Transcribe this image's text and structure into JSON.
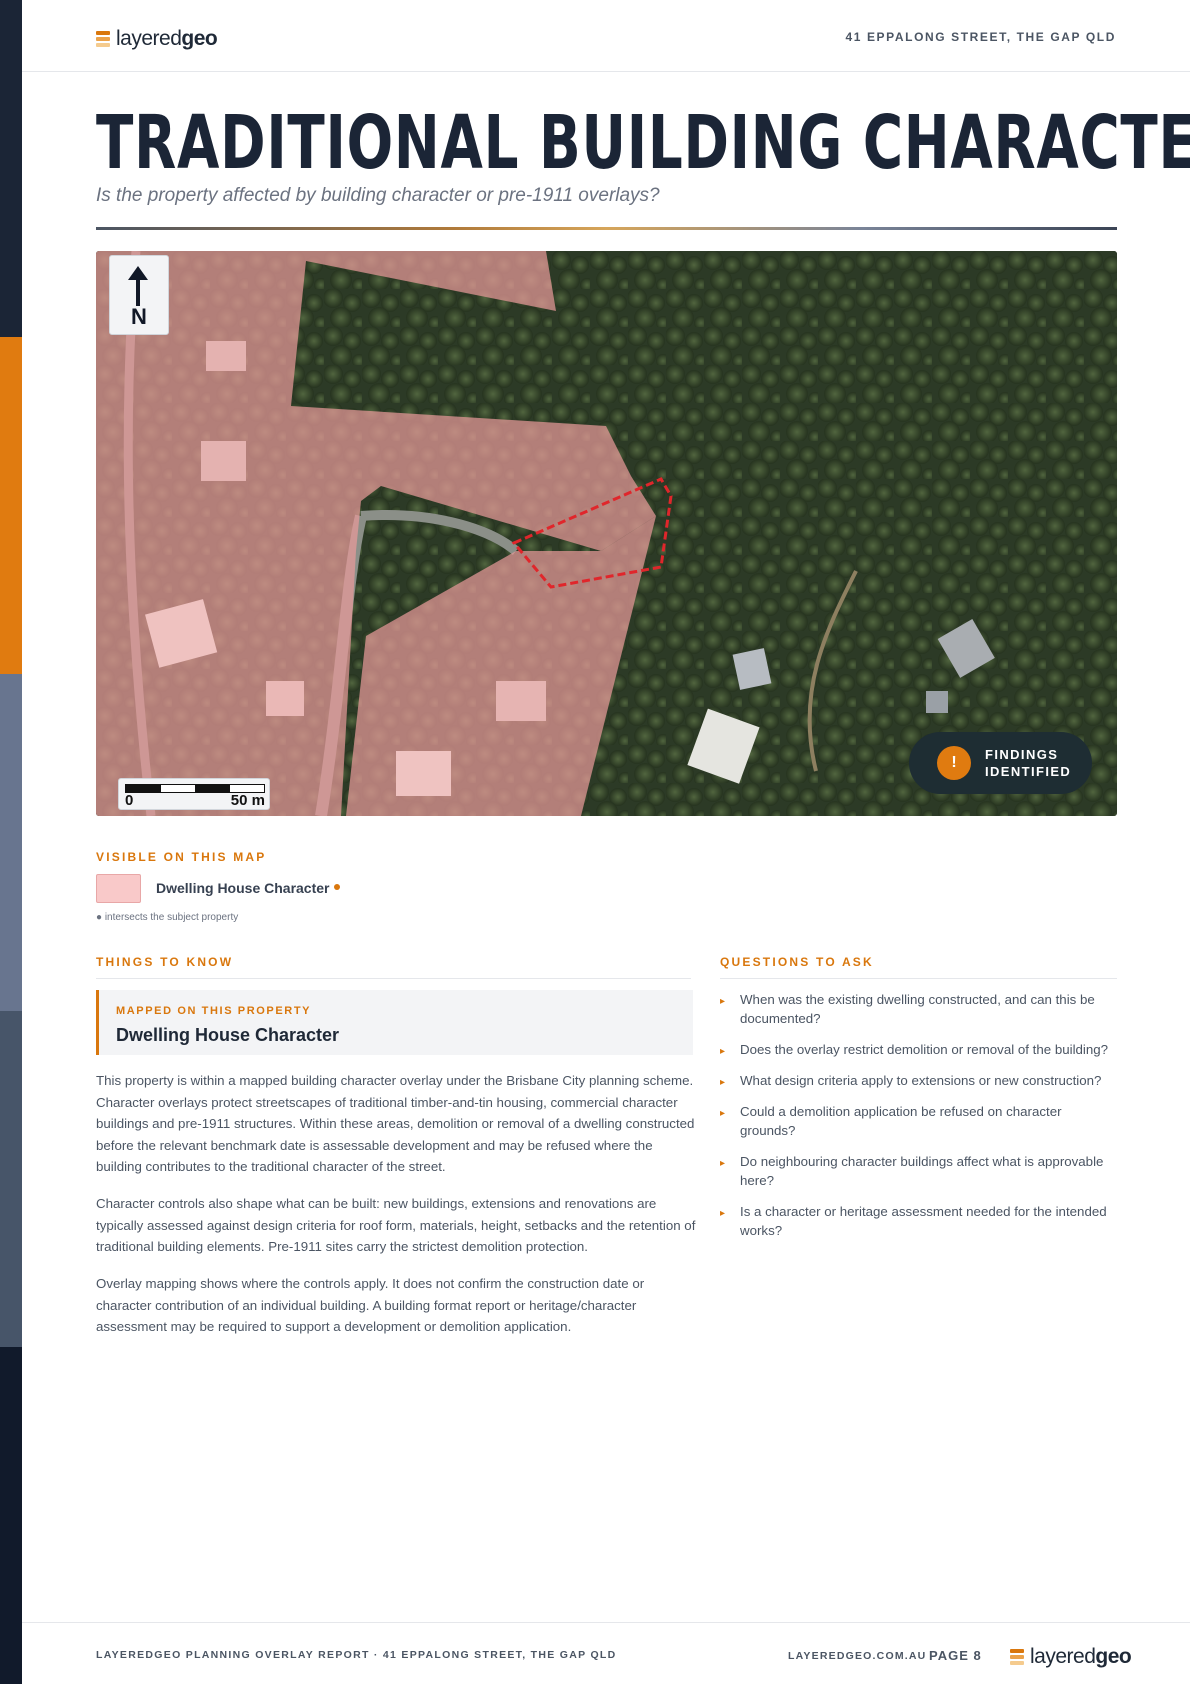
{
  "brand": {
    "logo_light": "layered",
    "logo_bold": "geo",
    "colors": {
      "orange": "#d9770d",
      "navy": "#1b2536",
      "overlay_pink": "#f9c9c9"
    }
  },
  "header": {
    "address": "41 EPPALONG STREET, THE GAP QLD"
  },
  "page": {
    "title": "TRADITIONAL BUILDING CHARACTER",
    "subtitle": "Is the property affected by building character or pre-1911 overlays?"
  },
  "map": {
    "north_label": "N",
    "scale_zero": "0",
    "scale_max": "50 m",
    "findings_line1": "FINDINGS",
    "findings_line2": "IDENTIFIED",
    "findings_icon": "!"
  },
  "legend": {
    "heading": "VISIBLE ON THIS MAP",
    "items": [
      {
        "label": "Dwelling House Character",
        "intersects": true
      }
    ],
    "note": "● intersects the subject property"
  },
  "things": {
    "heading": "THINGS TO KNOW",
    "mapped_label": "MAPPED ON THIS PROPERTY",
    "mapped_title": "Dwelling House Character",
    "paragraphs": [
      "This property is within a mapped building character overlay under the Brisbane City planning scheme. Character overlays protect streetscapes of traditional timber-and-tin housing, commercial character buildings and pre-1911 structures. Within these areas, demolition or removal of a dwelling constructed before the relevant benchmark date is assessable development and may be refused where the building contributes to the traditional character of the street.",
      "Character controls also shape what can be built: new buildings, extensions and renovations are typically assessed against design criteria for roof form, materials, height, setbacks and the retention of traditional building elements. Pre-1911 sites carry the strictest demolition protection.",
      "Overlay mapping shows where the controls apply. It does not confirm the construction date or character contribution of an individual building. A building format report or heritage/character assessment may be required to support a development or demolition application."
    ]
  },
  "questions": {
    "heading": "QUESTIONS TO ASK",
    "items": [
      "When was the existing dwelling constructed, and can this be documented?",
      "Does the overlay restrict demolition or removal of the building?",
      "What design criteria apply to extensions or new construction?",
      "Could a demolition application be refused on character grounds?",
      "Do neighbouring character buildings affect what is approvable here?",
      "Is a character or heritage assessment needed for the intended works?"
    ]
  },
  "footer": {
    "left": "LAYEREDGEO PLANNING OVERLAY REPORT · 41 EPPALONG STREET, THE GAP QLD",
    "site": "LAYEREDGEO.COM.AU",
    "page": "PAGE 8"
  }
}
